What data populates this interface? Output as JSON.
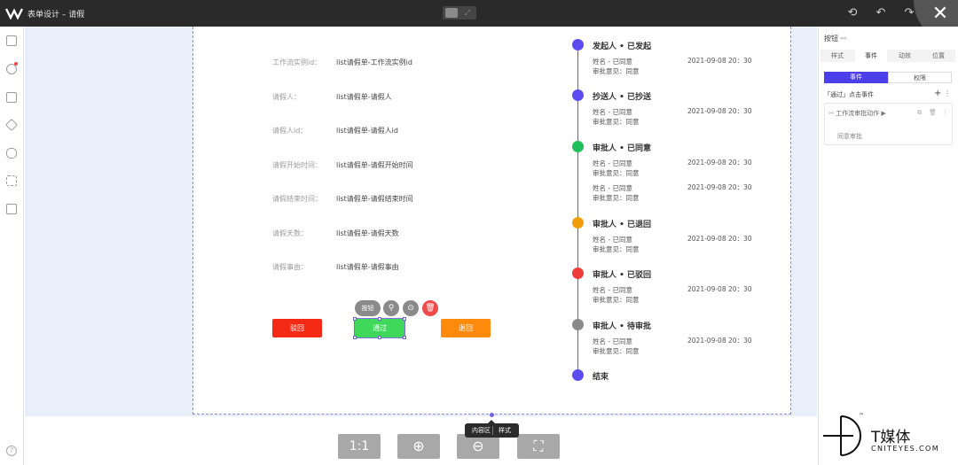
{
  "topbar": {
    "title": "表单设计 – 请假",
    "icons": [
      "history-icon",
      "undo-icon",
      "redo-icon"
    ],
    "close_glyph": "✕"
  },
  "form": {
    "fields": [
      {
        "label": "工作流实例id：",
        "value": "list请假单-工作流实例id"
      },
      {
        "label": "请假人：",
        "value": "list请假单-请假人"
      },
      {
        "label": "请假人id：",
        "value": "list请假单-请假人id"
      },
      {
        "label": "请假开始时间：",
        "value": "list请假单-请假开始时间"
      },
      {
        "label": "请假结束时间：",
        "value": "list请假单-请假结束时间"
      },
      {
        "label": "请假天数：",
        "value": "list请假单-请假天数"
      },
      {
        "label": "请假事由：",
        "value": "list请假单-请假事由"
      }
    ],
    "buttons": {
      "reject": "驳回",
      "pass": "通过",
      "return": "退回"
    },
    "toolbar_label": "按钮"
  },
  "timeline": {
    "nodes": [
      {
        "title": "发起人 • 已发起",
        "color": "#5a4cf0",
        "entries": [
          {
            "line1": "姓名 - 已同意",
            "line2": "审批意见：同意",
            "time": "2021-09-08 20：30"
          }
        ]
      },
      {
        "title": "抄送人 • 已抄送",
        "color": "#5a4cf0",
        "entries": [
          {
            "line1": "姓名 - 已同意",
            "line2": "审批意见：同意",
            "time": "2021-09-08 20：30"
          }
        ]
      },
      {
        "title": "审批人 • 已同意",
        "color": "#1fbf5c",
        "entries": [
          {
            "line1": "姓名 - 已同意",
            "line2": "审批意见：同意",
            "time": "2021-09-08 20：30"
          },
          {
            "line1": "姓名 - 已同意",
            "line2": "审批意见：同意",
            "time": "2021-09-08 20：30"
          }
        ]
      },
      {
        "title": "审批人 • 已退回",
        "color": "#f29d0c",
        "entries": [
          {
            "line1": "姓名 - 已同意",
            "line2": "审批意见：同意",
            "time": "2021-09-08 20：30"
          }
        ]
      },
      {
        "title": "审批人 • 已驳回",
        "color": "#f03b3b",
        "entries": [
          {
            "line1": "姓名 - 已同意",
            "line2": "审批意见：同意",
            "time": "2021-09-08 20：30"
          }
        ]
      },
      {
        "title": "审批人 • 待审批",
        "color": "#8a8a8a",
        "entries": [
          {
            "line1": "姓名 - 已同意",
            "line2": "审批意见：同意",
            "time": "2021-09-08 20：30"
          }
        ]
      },
      {
        "title": "结束",
        "color": "#5a4cf0",
        "entries": []
      }
    ]
  },
  "zoom": {
    "one_to_one": "1:1"
  },
  "tooltip": {
    "left": "内容区",
    "right": "样式"
  },
  "right_panel": {
    "title": "按钮",
    "tabs": [
      "样式",
      "事件",
      "动效",
      "位置"
    ],
    "active_tab": "事件",
    "segments": [
      "事件",
      "权限"
    ],
    "section_label": "「通过」点击事件",
    "action_label": "工作流审批动作",
    "sub_label": "同意审批"
  },
  "watermark": {
    "brand": "T媒体",
    "site": "CNITEYES.COM",
    "tm": "™"
  }
}
